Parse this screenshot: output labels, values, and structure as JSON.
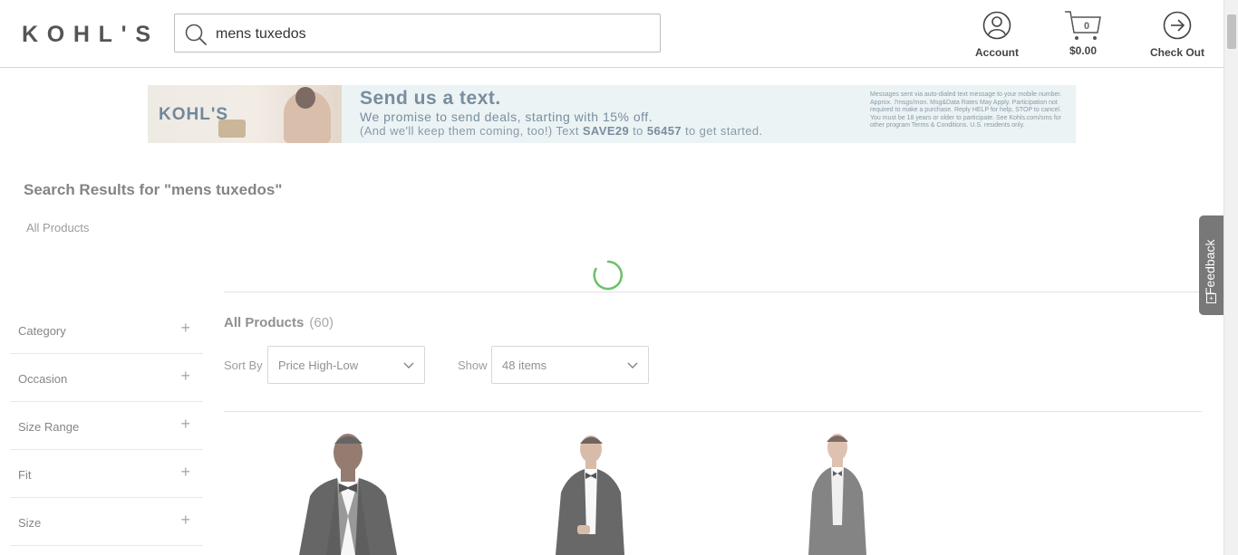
{
  "header": {
    "logo_text": "KOHL'S",
    "search_value": "mens tuxedos",
    "account_label": "Account",
    "cart_count": "0",
    "cart_total": "$0.00",
    "checkout_label": "Check Out"
  },
  "banner": {
    "logo_text": "KOHL'S",
    "title": "Send us a text.",
    "line2": "We promise to send deals, starting with 15% off.",
    "line3_prefix": "(And we'll keep them coming, too!) Text ",
    "keyword": "SAVE29",
    "line3_mid": " to ",
    "shortcode": "56457",
    "line3_suffix": " to get started.",
    "fine_print": "Messages sent via auto-dialed text message to your mobile number. Approx. 7msgs/mon. Msg&Data Rates May Apply. Participation not required to make a purchase. Reply HELP for help, STOP to cancel. You must be 18 years or older to participate. See Kohls.com/sms for other program Terms & Conditions. U.S. residents only."
  },
  "results": {
    "title": "Search Results for \"mens tuxedos\"",
    "breadcrumb": "All Products",
    "heading": "All Products",
    "count": "(60)"
  },
  "facets": [
    {
      "label": "Category"
    },
    {
      "label": "Occasion"
    },
    {
      "label": "Size Range"
    },
    {
      "label": "Fit"
    },
    {
      "label": "Size"
    }
  ],
  "sort": {
    "label": "Sort By",
    "value": "Price High-Low"
  },
  "show": {
    "label": "Show",
    "value": "48 items"
  },
  "feedback": {
    "label": "Feedback"
  },
  "colors": {
    "spinner": "#3aa935",
    "banner_bg": "#e3eff0",
    "banner_text": "#46627a",
    "feedback_bg": "#454545"
  }
}
